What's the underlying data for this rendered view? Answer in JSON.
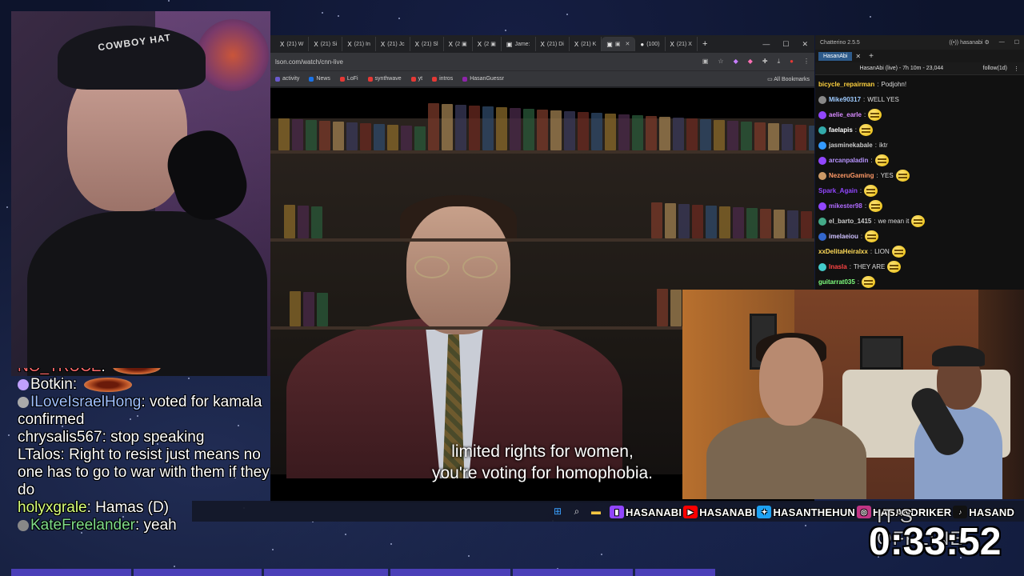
{
  "webcam": {
    "cap_text": "COWBOY HAT"
  },
  "browser": {
    "tabs": [
      {
        "icon": "X",
        "label": "(21) W"
      },
      {
        "icon": "X",
        "label": "(21) Si"
      },
      {
        "icon": "X",
        "label": "(21) In"
      },
      {
        "icon": "X",
        "label": "(21) Jc"
      },
      {
        "icon": "X",
        "label": "(21) Sl"
      },
      {
        "icon": "X",
        "label": "(2 ▣"
      },
      {
        "icon": "X",
        "label": "(2 ▣"
      },
      {
        "icon": "▣",
        "label": "Jame:"
      },
      {
        "icon": "X",
        "label": "(21) Di"
      },
      {
        "icon": "X",
        "label": "(21) K"
      },
      {
        "icon": "▣",
        "label": "▣"
      },
      {
        "icon": "●",
        "label": "(100)"
      },
      {
        "icon": "X",
        "label": "(21) X"
      }
    ],
    "url": "lson.com/watch/cnn-live",
    "bookmarks": [
      {
        "label": "activity",
        "color": "#6a5acd"
      },
      {
        "label": "News",
        "color": "#1a73e8"
      },
      {
        "label": "LoFi",
        "color": "#e53935"
      },
      {
        "label": "synthwave",
        "color": "#e53935"
      },
      {
        "label": "yt",
        "color": "#e53935"
      },
      {
        "label": "intros",
        "color": "#e53935"
      },
      {
        "label": "HasanGuessr",
        "color": "#8e24aa"
      }
    ],
    "all_bookmarks": "All Bookmarks"
  },
  "video": {
    "subtitle_line1": "limited rights for women,",
    "subtitle_line2": "you're voting for homophobia."
  },
  "chatterino": {
    "app_title": "Chatterino 2.5.5",
    "user": "hasanabi",
    "tab": "HasanAbi",
    "stream_info": "HasanAbi (live) - 7h 10m - 23,044",
    "follow": "follow(1d)",
    "messages": [
      {
        "user": "bicycle_repairman",
        "color": "#ffd23f",
        "text": "Podjohn!",
        "emote": false,
        "badge": ""
      },
      {
        "user": "Mike90317",
        "color": "#9ecbff",
        "text": "WELL YES",
        "emote": false,
        "badge": "#888"
      },
      {
        "user": "aelie_earle",
        "color": "#d78aff",
        "text": "",
        "emote": true,
        "badge": "#9146ff"
      },
      {
        "user": "faelapis",
        "color": "#ffffff",
        "text": "",
        "emote": true,
        "badge": "#3aa"
      },
      {
        "user": "jasminekabale",
        "color": "#cccccc",
        "text": "iktr",
        "emote": false,
        "badge": "#39f"
      },
      {
        "user": "arcanpaladin",
        "color": "#b794ff",
        "text": "",
        "emote": true,
        "badge": "#9146ff"
      },
      {
        "user": "NezeruGaming",
        "color": "#ff9966",
        "text": "YES",
        "emote": true,
        "badge": "#c96"
      },
      {
        "user": "Spark_Again",
        "color": "#9146ff",
        "text": "",
        "emote": true,
        "badge": ""
      },
      {
        "user": "mikester98",
        "color": "#b06bff",
        "text": "",
        "emote": true,
        "badge": "#9146ff"
      },
      {
        "user": "el_barto_1415",
        "color": "#cccccc",
        "text": "we mean it",
        "emote": true,
        "badge": "#4a8"
      },
      {
        "user": "imelaeiou",
        "color": "#cfc1ff",
        "text": "",
        "emote": true,
        "badge": "#36c"
      },
      {
        "user": "xxDelitaHeiralxx",
        "color": "#ffdb58",
        "text": "LION",
        "emote": true,
        "badge": ""
      },
      {
        "user": "lnasla",
        "color": "#ff4444",
        "text": "THEY ARE",
        "emote": true,
        "badge": "#4cc"
      },
      {
        "user": "guitarrat035",
        "color": "#7fff7f",
        "text": "",
        "emote": true,
        "badge": ""
      }
    ]
  },
  "socials": [
    {
      "icon": "twitch",
      "label": "HASANABI",
      "color": "#9146ff"
    },
    {
      "icon": "youtube",
      "label": "HASANABI",
      "color": "#ff0000"
    },
    {
      "icon": "twitter",
      "label": "HASANTHEHUN",
      "color": "#1da1f2"
    },
    {
      "icon": "instagram",
      "label": "HASANDRIKER",
      "color": "#c13584"
    },
    {
      "icon": "tiktok",
      "label": "HASAND",
      "color": "#111111"
    }
  ],
  "overlay_chat": [
    {
      "user": "NO_TRUCE",
      "color": "#ff6b6b",
      "text": "",
      "badge": "",
      "emote": true
    },
    {
      "user": "Botkin",
      "color": "#ffffff",
      "text": "",
      "badge": "#c0a0ff",
      "emote": true
    },
    {
      "user": "ILoveIsraelHong",
      "color": "#9fc0ff",
      "text": "voted for kamala confirmed",
      "badge": "#aaa",
      "emote": false
    },
    {
      "user": "chrysalis567",
      "color": "#ffffff",
      "text": "stop speaking",
      "badge": "",
      "emote": false
    },
    {
      "user": "LTalos",
      "color": "#ffffff",
      "text": "Right to resist just means no one has to go to war with them if they do",
      "badge": "",
      "emote": false
    },
    {
      "user": "holyxgrale",
      "color": "#d9ff7a",
      "text": "Hamas (D)",
      "badge": "",
      "emote": false
    },
    {
      "user": "KateFreelander",
      "color": "#7fdc8a",
      "text": "yeah",
      "badge": "#888",
      "emote": false
    }
  ],
  "timer": {
    "status": "IT'S OFFLINE",
    "time": "0:33:52"
  }
}
